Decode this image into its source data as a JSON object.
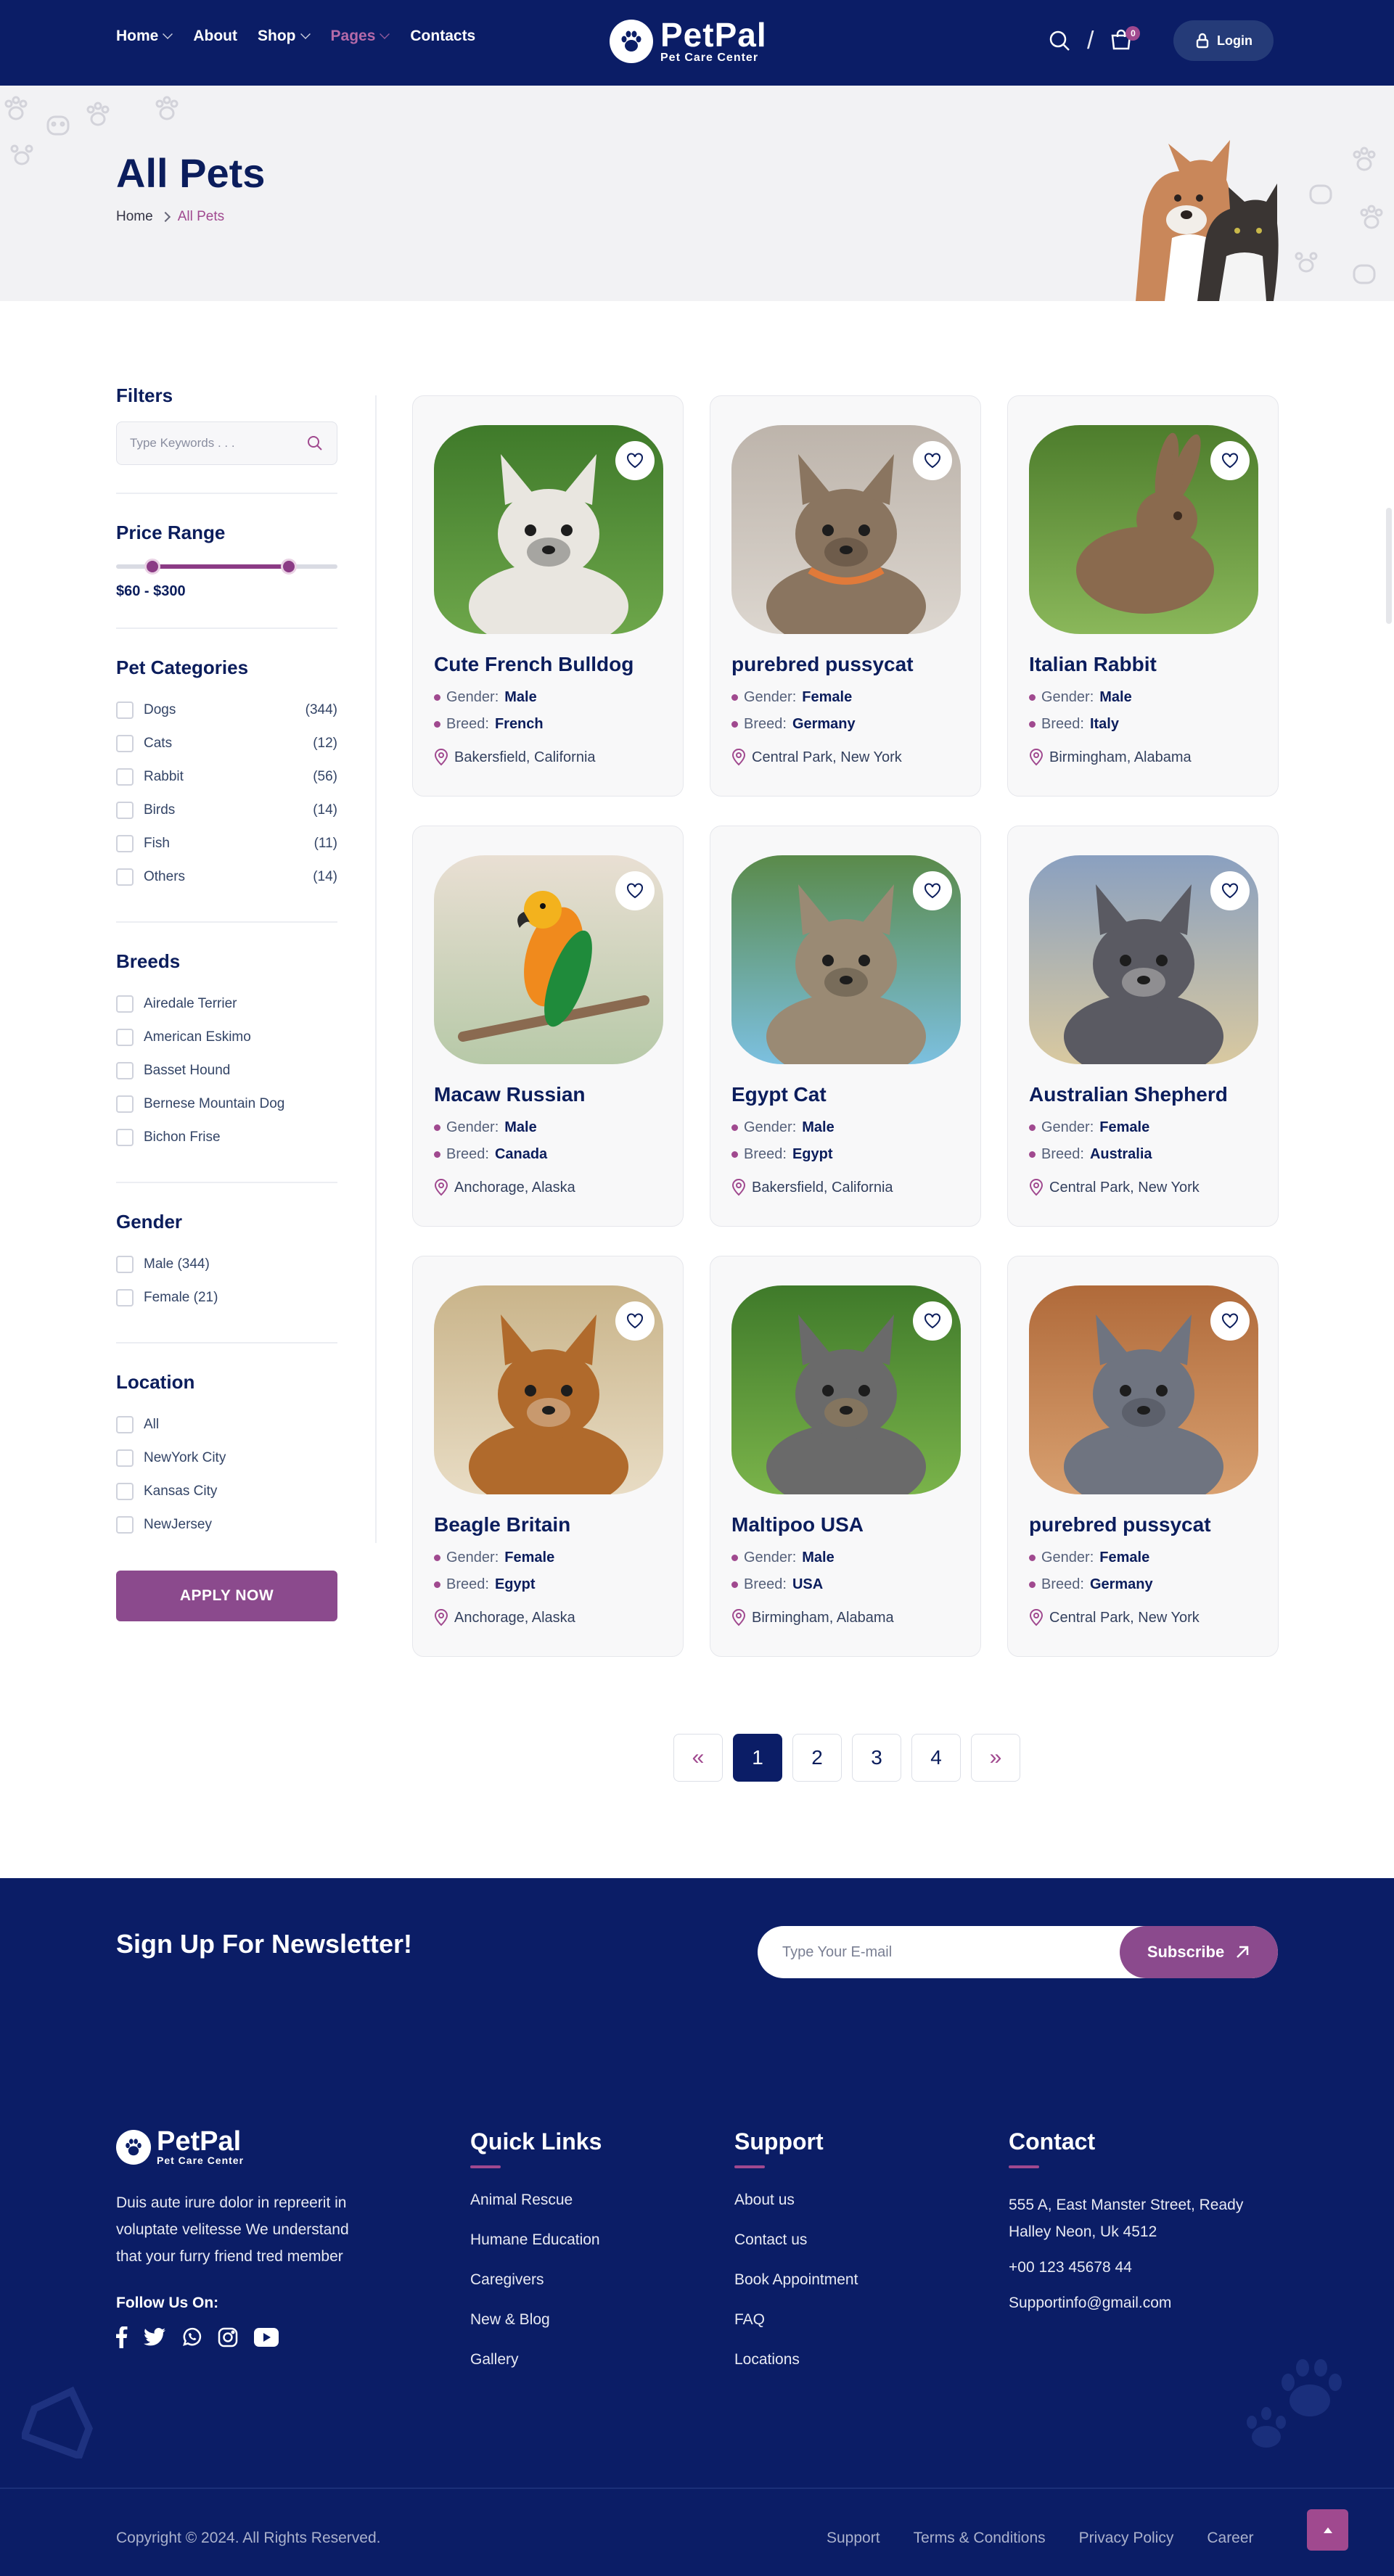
{
  "header": {
    "nav": [
      {
        "label": "Home",
        "dropdown": true,
        "active": false
      },
      {
        "label": "About",
        "dropdown": false,
        "active": false
      },
      {
        "label": "Shop",
        "dropdown": true,
        "active": false
      },
      {
        "label": "Pages",
        "dropdown": true,
        "active": true
      },
      {
        "label": "Contacts",
        "dropdown": false,
        "active": false
      }
    ],
    "logo_title": "PetPal",
    "logo_sub": "Pet Care Center",
    "cart_count": "0",
    "login_label": "Login",
    "colors": {
      "navy": "#0b1d66",
      "accent": "#a0498f"
    }
  },
  "banner": {
    "title": "All Pets",
    "breadcrumb": [
      "Home",
      "All Pets"
    ]
  },
  "filters": {
    "title": "Filters",
    "search_placeholder": "Type Keywords . . .",
    "price": {
      "title": "Price Range",
      "value": "$60 - $300",
      "min_fraction": 0.16,
      "max_fraction": 0.78
    },
    "categories": {
      "title": "Pet Categories",
      "items": [
        {
          "label": "Dogs",
          "count": "(344)"
        },
        {
          "label": "Cats",
          "count": "(12)"
        },
        {
          "label": "Rabbit",
          "count": "(56)"
        },
        {
          "label": "Birds",
          "count": "(14)"
        },
        {
          "label": "Fish",
          "count": "(11)"
        },
        {
          "label": "Others",
          "count": "(14)"
        }
      ]
    },
    "breeds": {
      "title": "Breeds",
      "items": [
        "Airedale Terrier",
        "American Eskimo",
        "Basset Hound",
        "Bernese Mountain Dog",
        "Bichon Frise"
      ]
    },
    "gender": {
      "title": "Gender",
      "items": [
        "Male (344)",
        "Female (21)"
      ]
    },
    "location": {
      "title": "Location",
      "items": [
        "All",
        "NewYork City",
        "Kansas City",
        "NewJersey"
      ]
    },
    "apply_label": "APPLY NOW"
  },
  "pets": [
    {
      "name": "Cute French Bulldog",
      "gender": "Male",
      "breed": "French",
      "location": "Bakersfield, California",
      "image": "french-bulldog-on-grass"
    },
    {
      "name": "purebred pussycat",
      "gender": "Female",
      "breed": "Germany",
      "location": "Central Park, New York",
      "image": "tabby-cat-with-collar"
    },
    {
      "name": "Italian Rabbit",
      "gender": "Male",
      "breed": "Italy",
      "location": "Birmingham, Alabama",
      "image": "brown-rabbit-on-grass"
    },
    {
      "name": "Macaw Russian",
      "gender": "Male",
      "breed": "Canada",
      "location": "Anchorage, Alaska",
      "image": "parrot-on-branch"
    },
    {
      "name": "Egypt Cat",
      "gender": "Male",
      "breed": "Egypt",
      "location": "Bakersfield, California",
      "image": "tabby-cat-lying"
    },
    {
      "name": "Australian Shepherd",
      "gender": "Female",
      "breed": "Australia",
      "location": "Central Park, New York",
      "image": "australian-shepherd-dog"
    },
    {
      "name": "Beagle Britain",
      "gender": "Female",
      "breed": "Egypt",
      "location": "Anchorage, Alaska",
      "image": "beagle-lying"
    },
    {
      "name": "Maltipoo USA",
      "gender": "Male",
      "breed": "USA",
      "location": "Birmingham, Alabama",
      "image": "small-terrier-on-grass"
    },
    {
      "name": "purebred pussycat",
      "gender": "Female",
      "breed": "Germany",
      "location": "Central Park, New York",
      "image": "grey-cat-lying"
    }
  ],
  "labels": {
    "gender": "Gender:",
    "breed": "Breed:"
  },
  "pagination": {
    "pages": [
      "1",
      "2",
      "3",
      "4"
    ],
    "current": "1",
    "prev": "«",
    "next": "»"
  },
  "newsletter": {
    "title": "Sign Up For Newsletter!",
    "placeholder": "Type Your E-mail",
    "button": "Subscribe"
  },
  "footer": {
    "logo_title": "PetPal",
    "logo_sub": "Pet Care Center",
    "about": "Duis aute irure dolor in repreerit in voluptate velitesse We understand that your furry friend tred member",
    "follow": "Follow Us On:",
    "socials": [
      "facebook-icon",
      "twitter-icon",
      "whatsapp-icon",
      "instagram-icon",
      "youtube-icon"
    ],
    "quick": {
      "title": "Quick Links",
      "links": [
        "Animal Rescue",
        "Humane Education",
        "Caregivers",
        "New & Blog",
        "Gallery"
      ]
    },
    "support": {
      "title": "Support",
      "links": [
        "About us",
        "Contact us",
        "Book Appointment",
        "FAQ",
        "Locations"
      ]
    },
    "contact": {
      "title": "Contact",
      "address": "555 A, East Manster Street, Ready Halley Neon, Uk 4512",
      "phone": "+00 123 45678 44",
      "email": "Supportinfo@gmail.com"
    },
    "copyright": "Copyright © 2024. All Rights Reserved.",
    "bottom_links": [
      "Support",
      "Terms & Conditions",
      "Privacy Policy",
      "Career"
    ]
  }
}
